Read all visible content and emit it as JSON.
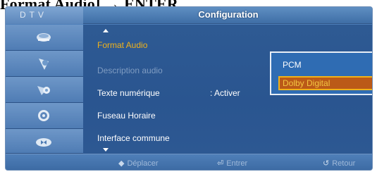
{
  "doc_heading": "Format Audio] → ENTER",
  "window": {
    "brand": "DTV",
    "title": "Configuration"
  },
  "sidebar": {
    "items": [
      {
        "icon": "picture-icon"
      },
      {
        "icon": "sound-icon"
      },
      {
        "icon": "channel-icon"
      },
      {
        "icon": "setup-gear-icon"
      },
      {
        "icon": "input-icon"
      }
    ]
  },
  "menu": {
    "items": [
      {
        "label": "Format Audio",
        "state": "active"
      },
      {
        "label": "Description audio",
        "state": "disabled"
      },
      {
        "label": "Texte numérique",
        "value": ": Activer"
      },
      {
        "label": "Fuseau Horaire"
      },
      {
        "label": "Interface commune"
      }
    ]
  },
  "popup": {
    "options": [
      {
        "label": "PCM"
      },
      {
        "label": "Dolby Digital",
        "selected": true
      }
    ]
  },
  "footer": {
    "move": "Déplacer",
    "enter": "Entrer",
    "return": "Retour"
  },
  "colors": {
    "active_text": "#f0b21a",
    "highlight_fill": "#bb5a18",
    "panel_blue": "#2e5a93"
  }
}
